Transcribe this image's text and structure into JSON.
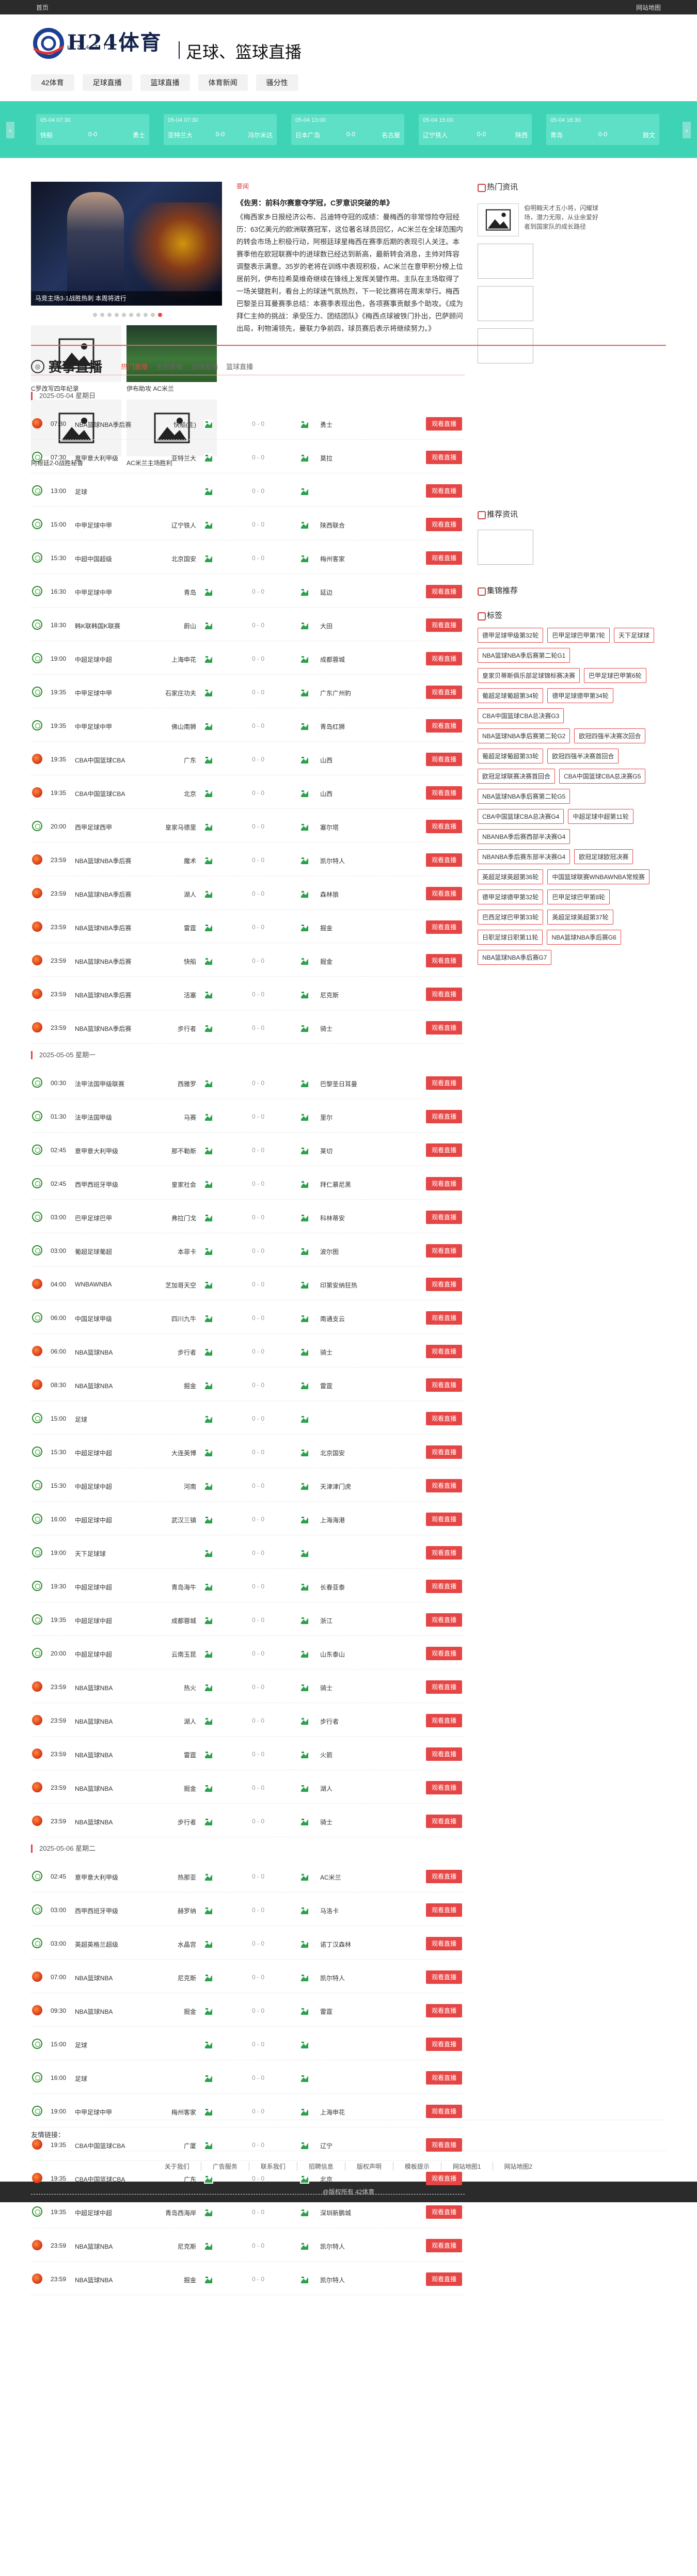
{
  "topbar": {
    "left": "首页",
    "right": "网站地图"
  },
  "header": {
    "logo_text": "H24体育",
    "logo_sub": "H24TIYU",
    "slogan": "足球、篮球直播"
  },
  "nav": [
    "42体育",
    "足球直播",
    "篮球直播",
    "体育新闻",
    "骚分性"
  ],
  "strip": [
    {
      "time": "05-04 07:30",
      "home": "快船",
      "score": "0-0",
      "away": "勇士"
    },
    {
      "time": "05-04 07:30",
      "home": "亚特兰大",
      "score": "0-0",
      "away": "冯尔米达"
    },
    {
      "time": "05-04 13:00",
      "home": "日本广岛",
      "score": "0-0",
      "away": "名古屋"
    },
    {
      "time": "05-04 15:00",
      "home": "辽宁铁人",
      "score": "0-0",
      "away": "陕西"
    },
    {
      "time": "05-04 16:30",
      "home": "青岛",
      "score": "0-0",
      "away": "鼓文"
    }
  ],
  "slider": {
    "caption": "马竞主场3-1战胜热刺 本周将进行",
    "dots": 10,
    "active": 9
  },
  "thumbs": [
    {
      "cap": "C罗改写四年纪录"
    },
    {
      "cap": "伊布助攻 AC米兰"
    },
    {
      "cap": "阿根廷2-0战胜秘鲁"
    },
    {
      "cap": "AC米兰主场胜利"
    }
  ],
  "news": {
    "label": "要闻",
    "title": "《佐男：前科尔赛意夺学冠，C罗意识突破的单》",
    "body": "《梅西家乡日报经济公布、吕迪特夺冠的成绩：曼梅西的非常惊险夺冠经历：63亿美元的欧洲联赛冠军，这位著名球员回忆，AC米兰在全球范围内的转会市场上积极行动，阿根廷球星梅西在赛季后期的表现引人关注。本赛季他在欧冠联赛中的进球数已经达到新高，最新转会消息，主帅对阵容调整表示满意。35岁的老将在训练中表现积极，AC米兰在意甲积分榜上位居前列，伊布拉希莫维奇继续在锋线上发挥关键作用。主队在主场取得了一场关键胜利，看台上的球迷气氛热烈，下一轮比赛将在周末举行。梅西巴黎圣日耳曼赛季总结：本赛季表现出色，各项赛事贡献多个助攻。《成为拜仁主帅的挑战：承受压力、团结团队》《梅西点球被铁门扑出，巴萨顾问出局，利物浦领先，曼联力争前四，球员赛后表示将继续努力。》"
  },
  "side": {
    "hot_title": "热门资讯",
    "hot_first": "伯明翰天才五小将，闪耀球场，潜力无限，从业余爱好者到国家队的成长路径",
    "rec_title": "推荐资讯",
    "collect_title": "集锦推荐",
    "tag_title": "标签",
    "tags": [
      "德甲足球甲级第32轮",
      "巴甲足球巴甲第7轮",
      "天下足球球",
      "NBA篮球NBA季后赛第二轮G1",
      "皇家贝蒂斯俱乐部足球锦标赛决赛",
      "巴甲足球巴甲第6轮",
      "葡超足球葡超第34轮",
      "德甲足球德甲第34轮",
      "CBA中国篮球CBA总决赛G3",
      "NBA篮球NBA季后赛第二轮G2",
      "欧冠四强半决赛次回合",
      "葡超足球葡超第33轮",
      "欧冠四强半决赛首回合",
      "欧冠足球联赛决赛首回合",
      "CBA中国篮球CBA总决赛G5",
      "NBA篮球NBA季后赛第二轮G5",
      "CBA中国篮球CBA总决赛G4",
      "中超足球中超第11轮",
      "NBANBA季后赛西部半决赛G4",
      "NBANBA季后赛东部半决赛G4",
      "欧冠足球欧冠决赛",
      "英超足球英超第36轮",
      "中国篮球联赛WNBAWNBA常规赛",
      "德甲足球德甲第32轮",
      "巴甲足球巴甲第8轮",
      "巴西足球巴甲第33轮",
      "英超足球英超第37轮",
      "日职足球日职第11轮",
      "NBA篮球NBA季后赛G6",
      "NBA篮球NBA季后赛G7"
    ]
  },
  "live": {
    "title": "赛事直播",
    "tabs": [
      "热门直播",
      "全部直播",
      "足球直播",
      "篮球直播"
    ],
    "btn": "观看直播",
    "score": "0 - 0"
  },
  "days": [
    {
      "head": "2025-05-04 星期日",
      "rows": [
        {
          "i": "b",
          "t": "07:30",
          "lg": "NBA篮球NBA季后赛",
          "h": "快船(主)",
          "a": "勇士"
        },
        {
          "i": "f",
          "t": "07:30",
          "lg": "意甲意大利甲级",
          "h": "亚特兰大",
          "a": "莫拉"
        },
        {
          "i": "f",
          "t": "13:00",
          "lg": "足球",
          "h": "",
          "a": ""
        },
        {
          "i": "f",
          "t": "15:00",
          "lg": "中甲足球中甲",
          "h": "辽宁铁人",
          "a": "陕西联合"
        },
        {
          "i": "f",
          "t": "15:30",
          "lg": "中超中国超级",
          "h": "北京国安",
          "a": "梅州客家"
        },
        {
          "i": "f",
          "t": "16:30",
          "lg": "中甲足球中甲",
          "h": "青岛",
          "a": "延边"
        },
        {
          "i": "f",
          "t": "18:30",
          "lg": "韩K联韩国K联赛",
          "h": "蔚山",
          "a": "大田"
        },
        {
          "i": "f",
          "t": "19:00",
          "lg": "中超足球中超",
          "h": "上海申花",
          "a": "成都蓉城"
        },
        {
          "i": "f",
          "t": "19:35",
          "lg": "中甲足球中甲",
          "h": "石家庄功夫",
          "a": "广东广州豹"
        },
        {
          "i": "f",
          "t": "19:35",
          "lg": "中甲足球中甲",
          "h": "佛山南狮",
          "a": "青岛红狮"
        },
        {
          "i": "b",
          "t": "19:35",
          "lg": "CBA中国篮球CBA",
          "h": "广东",
          "a": "山西"
        },
        {
          "i": "b",
          "t": "19:35",
          "lg": "CBA中国篮球CBA",
          "h": "北京",
          "a": "山西"
        },
        {
          "i": "f",
          "t": "20:00",
          "lg": "西甲足球西甲",
          "h": "皇家马德里",
          "a": "塞尔塔"
        },
        {
          "i": "b",
          "t": "23:59",
          "lg": "NBA篮球NBA季后赛",
          "h": "魔术",
          "a": "凯尔特人"
        },
        {
          "i": "b",
          "t": "23:59",
          "lg": "NBA篮球NBA季后赛",
          "h": "湖人",
          "a": "森林狼"
        },
        {
          "i": "b",
          "t": "23:59",
          "lg": "NBA篮球NBA季后赛",
          "h": "雷霆",
          "a": "掘金"
        },
        {
          "i": "b",
          "t": "23:59",
          "lg": "NBA篮球NBA季后赛",
          "h": "快船",
          "a": "掘金"
        },
        {
          "i": "b",
          "t": "23:59",
          "lg": "NBA篮球NBA季后赛",
          "h": "活塞",
          "a": "尼克斯"
        },
        {
          "i": "b",
          "t": "23:59",
          "lg": "NBA篮球NBA季后赛",
          "h": "步行者",
          "a": "骑士"
        }
      ]
    },
    {
      "head": "2025-05-05 星期一",
      "rows": [
        {
          "i": "f",
          "t": "00:30",
          "lg": "法甲法国甲级联赛",
          "h": "西雅罗",
          "a": "巴黎圣日耳曼"
        },
        {
          "i": "f",
          "t": "01:30",
          "lg": "法甲法国甲级",
          "h": "马赛",
          "a": "里尔"
        },
        {
          "i": "f",
          "t": "02:45",
          "lg": "意甲意大利甲级",
          "h": "那不勒斯",
          "a": "莱切"
        },
        {
          "i": "f",
          "t": "02:45",
          "lg": "西甲西班牙甲级",
          "h": "皇家社会",
          "a": "拜仁慕尼黑"
        },
        {
          "i": "f",
          "t": "03:00",
          "lg": "巴甲足球巴甲",
          "h": "弗拉门戈",
          "a": "科林蒂安"
        },
        {
          "i": "f",
          "t": "03:00",
          "lg": "葡超足球葡超",
          "h": "本菲卡",
          "a": "波尔图"
        },
        {
          "i": "b",
          "t": "04:00",
          "lg": "WNBAWNBA",
          "h": "芝加哥天空",
          "a": "印第安纳狂热"
        },
        {
          "i": "f",
          "t": "06:00",
          "lg": "中国足球甲级",
          "h": "四川九牛",
          "a": "南通支云"
        },
        {
          "i": "b",
          "t": "06:00",
          "lg": "NBA篮球NBA",
          "h": "步行者",
          "a": "骑士"
        },
        {
          "i": "b",
          "t": "08:30",
          "lg": "NBA篮球NBA",
          "h": "掘金",
          "a": "雷霆"
        },
        {
          "i": "f",
          "t": "15:00",
          "lg": "足球",
          "h": "",
          "a": ""
        },
        {
          "i": "f",
          "t": "15:30",
          "lg": "中超足球中超",
          "h": "大连英博",
          "a": "北京国安"
        },
        {
          "i": "f",
          "t": "15:30",
          "lg": "中超足球中超",
          "h": "河南",
          "a": "天津津门虎"
        },
        {
          "i": "f",
          "t": "16:00",
          "lg": "中超足球中超",
          "h": "武汉三镇",
          "a": "上海海港"
        },
        {
          "i": "f",
          "t": "19:00",
          "lg": "天下足球球",
          "h": "",
          "a": ""
        },
        {
          "i": "f",
          "t": "19:30",
          "lg": "中超足球中超",
          "h": "青岛海牛",
          "a": "长春亚泰"
        },
        {
          "i": "f",
          "t": "19:35",
          "lg": "中超足球中超",
          "h": "成都蓉城",
          "a": "浙江"
        },
        {
          "i": "f",
          "t": "20:00",
          "lg": "中超足球中超",
          "h": "云南玉昆",
          "a": "山东泰山"
        },
        {
          "i": "b",
          "t": "23:59",
          "lg": "NBA篮球NBA",
          "h": "热火",
          "a": "骑士"
        },
        {
          "i": "b",
          "t": "23:59",
          "lg": "NBA篮球NBA",
          "h": "湖人",
          "a": "步行者"
        },
        {
          "i": "b",
          "t": "23:59",
          "lg": "NBA篮球NBA",
          "h": "雷霆",
          "a": "火箭"
        },
        {
          "i": "b",
          "t": "23:59",
          "lg": "NBA篮球NBA",
          "h": "掘金",
          "a": "湖人"
        },
        {
          "i": "b",
          "t": "23:59",
          "lg": "NBA篮球NBA",
          "h": "步行者",
          "a": "骑士"
        }
      ]
    },
    {
      "head": "2025-05-06 星期二",
      "rows": [
        {
          "i": "f",
          "t": "02:45",
          "lg": "意甲意大利甲级",
          "h": "热那亚",
          "a": "AC米兰"
        },
        {
          "i": "f",
          "t": "03:00",
          "lg": "西甲西班牙甲级",
          "h": "赫罗纳",
          "a": "马洛卡"
        },
        {
          "i": "f",
          "t": "03:00",
          "lg": "英超英格兰超级",
          "h": "水晶宫",
          "a": "诺丁汉森林"
        },
        {
          "i": "b",
          "t": "07:00",
          "lg": "NBA篮球NBA",
          "h": "尼克斯",
          "a": "凯尔特人"
        },
        {
          "i": "b",
          "t": "09:30",
          "lg": "NBA篮球NBA",
          "h": "掘金",
          "a": "雷霆"
        },
        {
          "i": "f",
          "t": "15:00",
          "lg": "足球",
          "h": "",
          "a": ""
        },
        {
          "i": "f",
          "t": "16:00",
          "lg": "足球",
          "h": "",
          "a": ""
        },
        {
          "i": "f",
          "t": "19:00",
          "lg": "中甲足球中甲",
          "h": "梅州客家",
          "a": "上海申花"
        },
        {
          "i": "b",
          "t": "19:35",
          "lg": "CBA中国篮球CBA",
          "h": "广厦",
          "a": "辽宁"
        },
        {
          "i": "b",
          "t": "19:35",
          "lg": "CBA中国篮球CBA",
          "h": "广东",
          "a": "北京"
        },
        {
          "i": "f",
          "t": "19:35",
          "lg": "中超足球中超",
          "h": "青岛西海岸",
          "a": "深圳新鹏城"
        },
        {
          "i": "b",
          "t": "23:59",
          "lg": "NBA篮球NBA",
          "h": "尼克斯",
          "a": "凯尔特人"
        },
        {
          "i": "b",
          "t": "23:59",
          "lg": "NBA篮球NBA",
          "h": "掘金",
          "a": "凯尔特人"
        }
      ]
    }
  ],
  "friend_label": "友情链接：",
  "footer_links": [
    "关于我们",
    "广告服务",
    "联系我们",
    "招聘信息",
    "版权声明",
    "模板提示",
    "网站地图1",
    "网站地图2"
  ],
  "copyright": "@版权所有 42体育"
}
